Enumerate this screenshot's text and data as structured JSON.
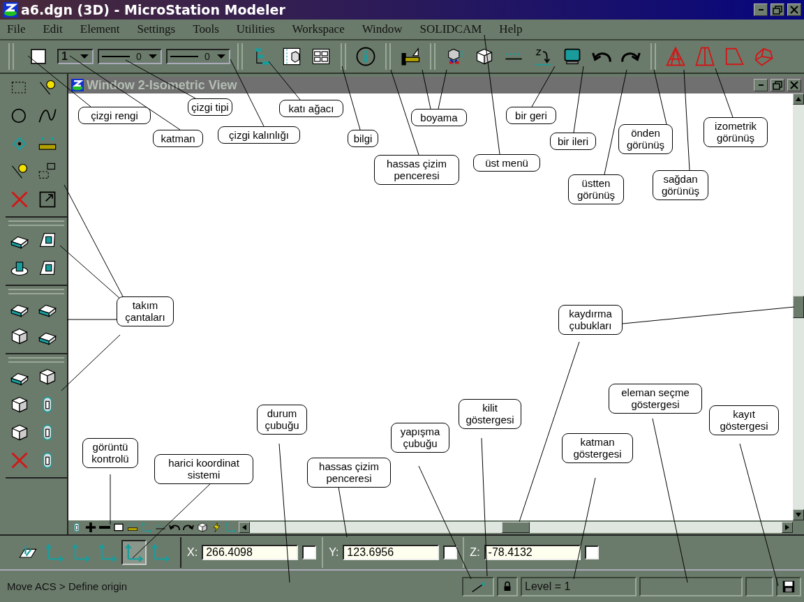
{
  "window": {
    "title": "a6.dgn (3D) - MicroStation Modeler"
  },
  "menu": [
    {
      "label": "File"
    },
    {
      "label": "Edit"
    },
    {
      "label": "Element"
    },
    {
      "label": "Settings"
    },
    {
      "label": "Tools"
    },
    {
      "label": "Utilities"
    },
    {
      "label": "Workspace"
    },
    {
      "label": "Window"
    },
    {
      "label": "SOLIDCAM"
    },
    {
      "label": "Help"
    }
  ],
  "attributes": {
    "color": "#ffffff",
    "level": "1",
    "line_style": "0",
    "line_weight": "0"
  },
  "view_window": {
    "title": "Window 2-Isometric View"
  },
  "callouts": [
    {
      "text": "çizgi rengi"
    },
    {
      "text": "katman"
    },
    {
      "text": "çizgi tipi"
    },
    {
      "text": "çizgi kalınlığı"
    },
    {
      "text": "katı ağacı"
    },
    {
      "text": "bilgi"
    },
    {
      "text": "boyama"
    },
    {
      "text": "hassas çizim penceresi"
    },
    {
      "text": "bir geri"
    },
    {
      "text": "üst menü"
    },
    {
      "text": "bir ileri"
    },
    {
      "text": "önden görünüş"
    },
    {
      "text": "izometrik görünüş"
    },
    {
      "text": "üstten görünüş"
    },
    {
      "text": "sağdan görünüş"
    },
    {
      "text": "takım çantaları"
    },
    {
      "text": "kaydırma çubukları"
    },
    {
      "text": "görüntü kontrolü"
    },
    {
      "text": "harici koordinat sistemi"
    },
    {
      "text": "durum çubuğu"
    },
    {
      "text": "hassas çizim penceresi"
    },
    {
      "text": "yapışma çubuğu"
    },
    {
      "text": "kilit göstergesi"
    },
    {
      "text": "eleman seçme göstergesi"
    },
    {
      "text": "katman göstergesi"
    },
    {
      "text": "kayıt göstergesi"
    }
  ],
  "acs_tools": [
    {
      "selected": false
    },
    {
      "selected": false
    },
    {
      "selected": false
    },
    {
      "selected": false
    },
    {
      "selected": true
    },
    {
      "selected": false
    }
  ],
  "coordinates": [
    {
      "axis": "X:",
      "value": "266.4098",
      "checked": false
    },
    {
      "axis": "Y:",
      "value": "123.6956",
      "checked": false
    },
    {
      "axis": "Z:",
      "value": "-78.4132",
      "checked": false
    }
  ],
  "status_bar": {
    "message": "Move ACS > Define origin",
    "level": "Level = 1"
  }
}
